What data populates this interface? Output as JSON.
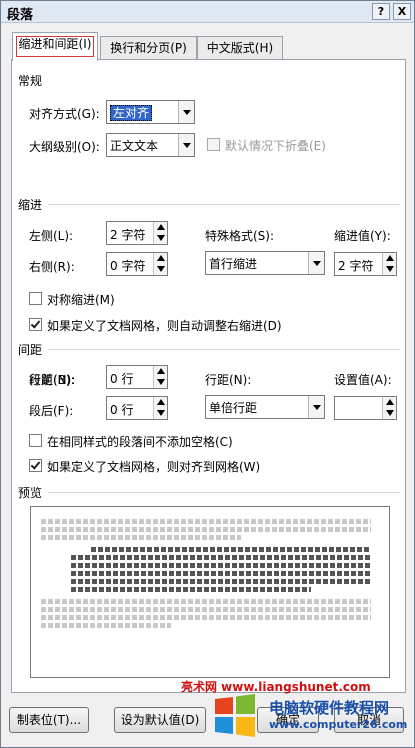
{
  "window": {
    "title": "段落",
    "help_btn": "?",
    "close_btn": "X"
  },
  "tabs": [
    {
      "label": "缩进和间距(I)",
      "active": true
    },
    {
      "label": "换行和分页(P)",
      "active": false
    },
    {
      "label": "中文版式(H)",
      "active": false
    }
  ],
  "general": {
    "section": "常规",
    "alignment_label": "对齐方式(G):",
    "alignment_value": "左对齐",
    "outline_label": "大纲级别(O):",
    "outline_value": "正文文本",
    "collapse_label": "默认情况下折叠(E)",
    "collapse_checked": false
  },
  "indent": {
    "section": "缩进",
    "left_label": "左侧(L):",
    "left_value": "2 字符",
    "right_label": "右侧(R):",
    "right_value": "0 字符",
    "special_label": "特殊格式(S):",
    "special_value": "首行缩进",
    "by_label": "缩进值(Y):",
    "by_value": "2 字符",
    "mirror_label": "对称缩进(M)",
    "mirror_checked": false,
    "auto_adjust_label": "如果定义了文档网格，则自动调整右缩进(D)",
    "auto_adjust_checked": true
  },
  "spacing": {
    "section": "间距",
    "before_label": "段前(B):",
    "before_value": "0 行",
    "after_label": "段后(F):",
    "after_value": "0 行",
    "line_label": "行距(N):",
    "line_value": "单倍行距",
    "at_label": "设置值(A):",
    "at_value": "",
    "no_space_label": "在相同样式的段落间不添加空格(C)",
    "no_space_checked": false,
    "snap_grid_label": "如果定义了文档网格，则对齐到网格(W)",
    "snap_grid_checked": true
  },
  "preview": {
    "section": "预览"
  },
  "buttons": {
    "tabs": "制表位(T)...",
    "default": "设为默认值(D)",
    "ok": "确定",
    "cancel": "取消"
  },
  "watermark": {
    "site1": "亮术网 www.liangshunet.com",
    "site2": "电脑软硬件教程网",
    "site3": "www.computer26.com"
  },
  "colors": {
    "focus_red": "#d23a3a",
    "selection_blue": "#3366cc",
    "watermark_red": "#d01010",
    "watermark_blue": "#1a4fa8"
  }
}
